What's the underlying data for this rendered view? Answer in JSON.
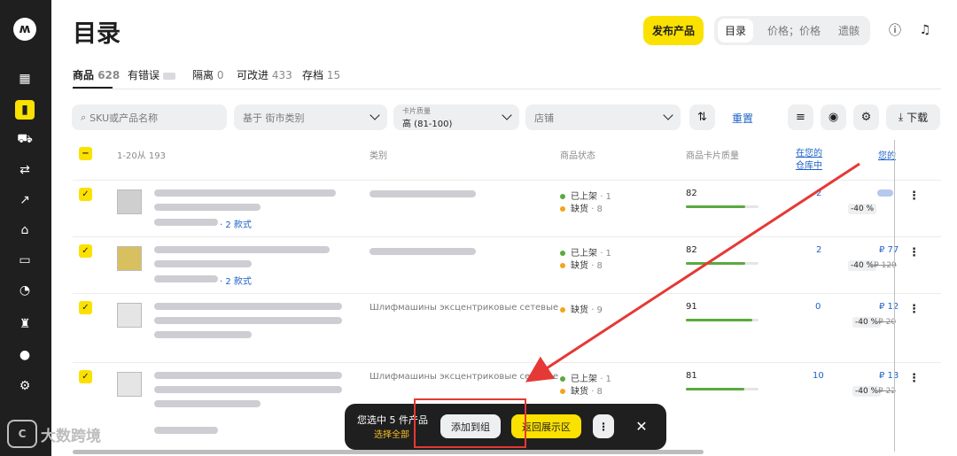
{
  "page": {
    "title": "目录"
  },
  "header": {
    "publish_label": "发布产品",
    "view_tabs": [
      {
        "label": "目录",
        "active": true
      },
      {
        "label": "价格；价格",
        "active": false
      },
      {
        "label": "遗骸",
        "active": false
      }
    ]
  },
  "tabs": [
    {
      "label": "商品",
      "count": "628",
      "active": true
    },
    {
      "label": "有错误",
      "count": "",
      "active": false
    },
    {
      "label": "隔离",
      "count": "0",
      "active": false
    },
    {
      "label": "可改进",
      "count": "433",
      "active": false
    },
    {
      "label": "存档",
      "count": "15",
      "active": false
    }
  ],
  "filters": {
    "search_placeholder": "SKU或产品名称",
    "category_placeholder": "基于 街市类别",
    "quality_label": "卡片质量",
    "quality_value": "高 (81-100)",
    "store_placeholder": "店铺",
    "reset_label": "重置",
    "download_label": "下载"
  },
  "table": {
    "range_label": "1-20从 193",
    "headers": {
      "category": "类别",
      "status": "商品状态",
      "quality": "商品卡片质量",
      "stock": "在您的仓库中",
      "price": "您的"
    },
    "rows": [
      {
        "variants": "· 2 款式",
        "category": "",
        "statuses": [
          {
            "label": "已上架",
            "count": "· 1",
            "color": "#5aa93f"
          },
          {
            "label": "缺货",
            "count": "· 8",
            "color": "#f2a51a"
          }
        ],
        "quality": "82",
        "quality_frac": 0.82,
        "stock": "2",
        "price": "",
        "discount": "-40 %",
        "oldprice": ""
      },
      {
        "variants": "· 2 款式",
        "category": "",
        "statuses": [
          {
            "label": "已上架",
            "count": "· 1",
            "color": "#5aa93f"
          },
          {
            "label": "缺货",
            "count": "· 8",
            "color": "#f2a51a"
          }
        ],
        "quality": "82",
        "quality_frac": 0.82,
        "stock": "2",
        "price": "₽ 77",
        "discount": "-40 %",
        "oldprice": "₽ 129"
      },
      {
        "variants": "",
        "category": "Шлифмашины эксцентриковые сетевые",
        "statuses": [
          {
            "label": "缺货",
            "count": "· 9",
            "color": "#f2a51a"
          }
        ],
        "quality": "91",
        "quality_frac": 0.91,
        "stock": "0",
        "price": "₽ 12",
        "discount": "-40 %",
        "oldprice": "₽ 20"
      },
      {
        "variants": "",
        "category": "Шлифмашины эксцентриковые сетевые",
        "statuses": [
          {
            "label": "已上架",
            "count": "· 1",
            "color": "#5aa93f"
          },
          {
            "label": "缺货",
            "count": "· 8",
            "color": "#f2a51a"
          }
        ],
        "quality": "81",
        "quality_frac": 0.81,
        "stock": "10",
        "price": "₽ 13",
        "discount": "-40 %",
        "oldprice": "₽ 22"
      }
    ]
  },
  "bottom_bar": {
    "selected_text": "您选中 5 件产品",
    "select_all": "选择全部",
    "add_group": "添加到组",
    "back": "返回展示区",
    "more": "⋮",
    "close": "✕"
  },
  "watermark": {
    "text": "大数跨境"
  },
  "colors": {
    "accent": "#fbe100",
    "link": "#1d62c9",
    "sidebar": "#1f1f1f",
    "annotation": "#e53935"
  },
  "icons": {
    "sidebar": [
      "logo-icon",
      "dashboard-icon",
      "catalog-icon",
      "cart-icon",
      "logistics-icon",
      "analytics-icon",
      "store-icon",
      "finance-icon",
      "reports-icon",
      "trophy-icon",
      "chat-icon",
      "settings-icon"
    ]
  }
}
